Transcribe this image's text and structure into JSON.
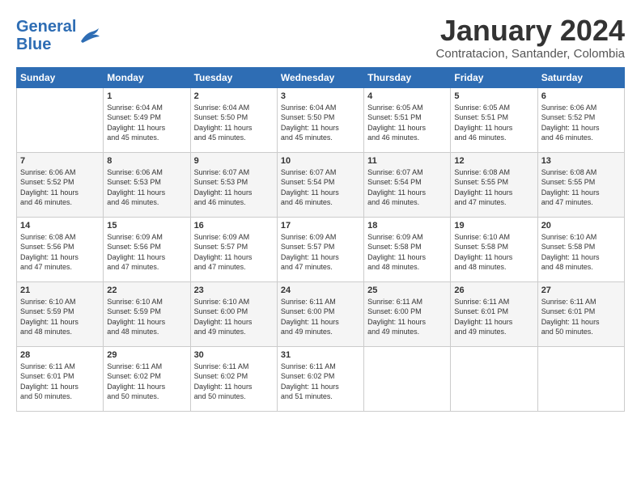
{
  "header": {
    "logo_line1": "General",
    "logo_line2": "Blue",
    "title": "January 2024",
    "subtitle": "Contratacion, Santander, Colombia"
  },
  "days_of_week": [
    "Sunday",
    "Monday",
    "Tuesday",
    "Wednesday",
    "Thursday",
    "Friday",
    "Saturday"
  ],
  "weeks": [
    [
      {
        "num": "",
        "info": ""
      },
      {
        "num": "1",
        "info": "Sunrise: 6:04 AM\nSunset: 5:49 PM\nDaylight: 11 hours\nand 45 minutes."
      },
      {
        "num": "2",
        "info": "Sunrise: 6:04 AM\nSunset: 5:50 PM\nDaylight: 11 hours\nand 45 minutes."
      },
      {
        "num": "3",
        "info": "Sunrise: 6:04 AM\nSunset: 5:50 PM\nDaylight: 11 hours\nand 45 minutes."
      },
      {
        "num": "4",
        "info": "Sunrise: 6:05 AM\nSunset: 5:51 PM\nDaylight: 11 hours\nand 46 minutes."
      },
      {
        "num": "5",
        "info": "Sunrise: 6:05 AM\nSunset: 5:51 PM\nDaylight: 11 hours\nand 46 minutes."
      },
      {
        "num": "6",
        "info": "Sunrise: 6:06 AM\nSunset: 5:52 PM\nDaylight: 11 hours\nand 46 minutes."
      }
    ],
    [
      {
        "num": "7",
        "info": "Sunrise: 6:06 AM\nSunset: 5:52 PM\nDaylight: 11 hours\nand 46 minutes."
      },
      {
        "num": "8",
        "info": "Sunrise: 6:06 AM\nSunset: 5:53 PM\nDaylight: 11 hours\nand 46 minutes."
      },
      {
        "num": "9",
        "info": "Sunrise: 6:07 AM\nSunset: 5:53 PM\nDaylight: 11 hours\nand 46 minutes."
      },
      {
        "num": "10",
        "info": "Sunrise: 6:07 AM\nSunset: 5:54 PM\nDaylight: 11 hours\nand 46 minutes."
      },
      {
        "num": "11",
        "info": "Sunrise: 6:07 AM\nSunset: 5:54 PM\nDaylight: 11 hours\nand 46 minutes."
      },
      {
        "num": "12",
        "info": "Sunrise: 6:08 AM\nSunset: 5:55 PM\nDaylight: 11 hours\nand 47 minutes."
      },
      {
        "num": "13",
        "info": "Sunrise: 6:08 AM\nSunset: 5:55 PM\nDaylight: 11 hours\nand 47 minutes."
      }
    ],
    [
      {
        "num": "14",
        "info": "Sunrise: 6:08 AM\nSunset: 5:56 PM\nDaylight: 11 hours\nand 47 minutes."
      },
      {
        "num": "15",
        "info": "Sunrise: 6:09 AM\nSunset: 5:56 PM\nDaylight: 11 hours\nand 47 minutes."
      },
      {
        "num": "16",
        "info": "Sunrise: 6:09 AM\nSunset: 5:57 PM\nDaylight: 11 hours\nand 47 minutes."
      },
      {
        "num": "17",
        "info": "Sunrise: 6:09 AM\nSunset: 5:57 PM\nDaylight: 11 hours\nand 47 minutes."
      },
      {
        "num": "18",
        "info": "Sunrise: 6:09 AM\nSunset: 5:58 PM\nDaylight: 11 hours\nand 48 minutes."
      },
      {
        "num": "19",
        "info": "Sunrise: 6:10 AM\nSunset: 5:58 PM\nDaylight: 11 hours\nand 48 minutes."
      },
      {
        "num": "20",
        "info": "Sunrise: 6:10 AM\nSunset: 5:58 PM\nDaylight: 11 hours\nand 48 minutes."
      }
    ],
    [
      {
        "num": "21",
        "info": "Sunrise: 6:10 AM\nSunset: 5:59 PM\nDaylight: 11 hours\nand 48 minutes."
      },
      {
        "num": "22",
        "info": "Sunrise: 6:10 AM\nSunset: 5:59 PM\nDaylight: 11 hours\nand 48 minutes."
      },
      {
        "num": "23",
        "info": "Sunrise: 6:10 AM\nSunset: 6:00 PM\nDaylight: 11 hours\nand 49 minutes."
      },
      {
        "num": "24",
        "info": "Sunrise: 6:11 AM\nSunset: 6:00 PM\nDaylight: 11 hours\nand 49 minutes."
      },
      {
        "num": "25",
        "info": "Sunrise: 6:11 AM\nSunset: 6:00 PM\nDaylight: 11 hours\nand 49 minutes."
      },
      {
        "num": "26",
        "info": "Sunrise: 6:11 AM\nSunset: 6:01 PM\nDaylight: 11 hours\nand 49 minutes."
      },
      {
        "num": "27",
        "info": "Sunrise: 6:11 AM\nSunset: 6:01 PM\nDaylight: 11 hours\nand 50 minutes."
      }
    ],
    [
      {
        "num": "28",
        "info": "Sunrise: 6:11 AM\nSunset: 6:01 PM\nDaylight: 11 hours\nand 50 minutes."
      },
      {
        "num": "29",
        "info": "Sunrise: 6:11 AM\nSunset: 6:02 PM\nDaylight: 11 hours\nand 50 minutes."
      },
      {
        "num": "30",
        "info": "Sunrise: 6:11 AM\nSunset: 6:02 PM\nDaylight: 11 hours\nand 50 minutes."
      },
      {
        "num": "31",
        "info": "Sunrise: 6:11 AM\nSunset: 6:02 PM\nDaylight: 11 hours\nand 51 minutes."
      },
      {
        "num": "",
        "info": ""
      },
      {
        "num": "",
        "info": ""
      },
      {
        "num": "",
        "info": ""
      }
    ]
  ]
}
